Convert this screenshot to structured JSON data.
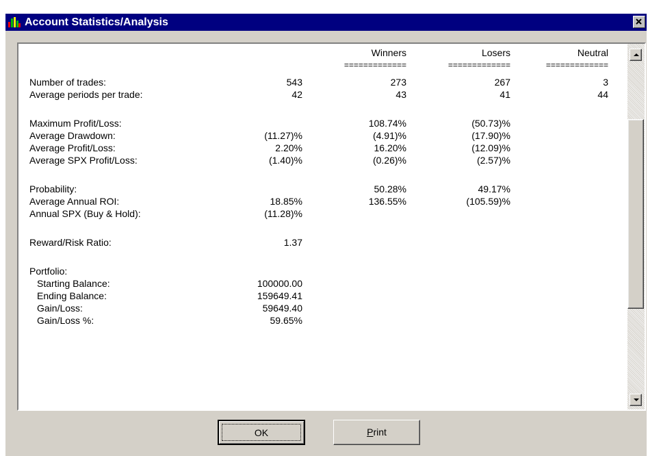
{
  "window": {
    "title": "Account Statistics/Analysis",
    "app_icon": "chart-bars-icon",
    "close_icon": "close-icon"
  },
  "report": {
    "headers": {
      "winners": "Winners",
      "losers": "Losers",
      "neutral": "Neutral",
      "separator": "============="
    },
    "rows": [
      {
        "label": "Number of trades:",
        "total": "543",
        "winners": "273",
        "losers": "267",
        "neutral": "3"
      },
      {
        "label": "Average periods per trade:",
        "total": "42",
        "winners": "43",
        "losers": "41",
        "neutral": "44"
      },
      {
        "label": "Maximum Profit/Loss:",
        "total": "",
        "winners": "108.74%",
        "losers": "(50.73)%",
        "neutral": ""
      },
      {
        "label": "Average Drawdown:",
        "total": "(11.27)%",
        "winners": "(4.91)%",
        "losers": "(17.90)%",
        "neutral": ""
      },
      {
        "label": "Average Profit/Loss:",
        "total": "2.20%",
        "winners": "16.20%",
        "losers": "(12.09)%",
        "neutral": ""
      },
      {
        "label": "Average SPX Profit/Loss:",
        "total": "(1.40)%",
        "winners": "(0.26)%",
        "losers": "(2.57)%",
        "neutral": ""
      },
      {
        "label": "Probability:",
        "total": "",
        "winners": "50.28%",
        "losers": "49.17%",
        "neutral": ""
      },
      {
        "label": "Average Annual ROI:",
        "total": "18.85%",
        "winners": "136.55%",
        "losers": "(105.59)%",
        "neutral": ""
      },
      {
        "label": "Annual SPX (Buy & Hold):",
        "total": "(11.28)%",
        "winners": "",
        "losers": "",
        "neutral": ""
      },
      {
        "label": "Reward/Risk Ratio:",
        "total": "1.37",
        "winners": "",
        "losers": "",
        "neutral": ""
      },
      {
        "label": "Portfolio:",
        "total": "",
        "winners": "",
        "losers": "",
        "neutral": ""
      },
      {
        "label": "Starting Balance:",
        "total": "100000.00",
        "winners": "",
        "losers": "",
        "neutral": ""
      },
      {
        "label": "Ending Balance:",
        "total": "159649.41",
        "winners": "",
        "losers": "",
        "neutral": ""
      },
      {
        "label": "Gain/Loss:",
        "total": "59649.40",
        "winners": "",
        "losers": "",
        "neutral": ""
      },
      {
        "label": "Gain/Loss %:",
        "total": "59.65%",
        "winners": "",
        "losers": "",
        "neutral": ""
      }
    ]
  },
  "scrollbar": {
    "up_icon": "arrow-up-icon",
    "down_icon": "arrow-down-icon"
  },
  "buttons": {
    "ok_label": "OK",
    "print_label_pre": "",
    "print_label_accel": "P",
    "print_label_post": "rint"
  }
}
